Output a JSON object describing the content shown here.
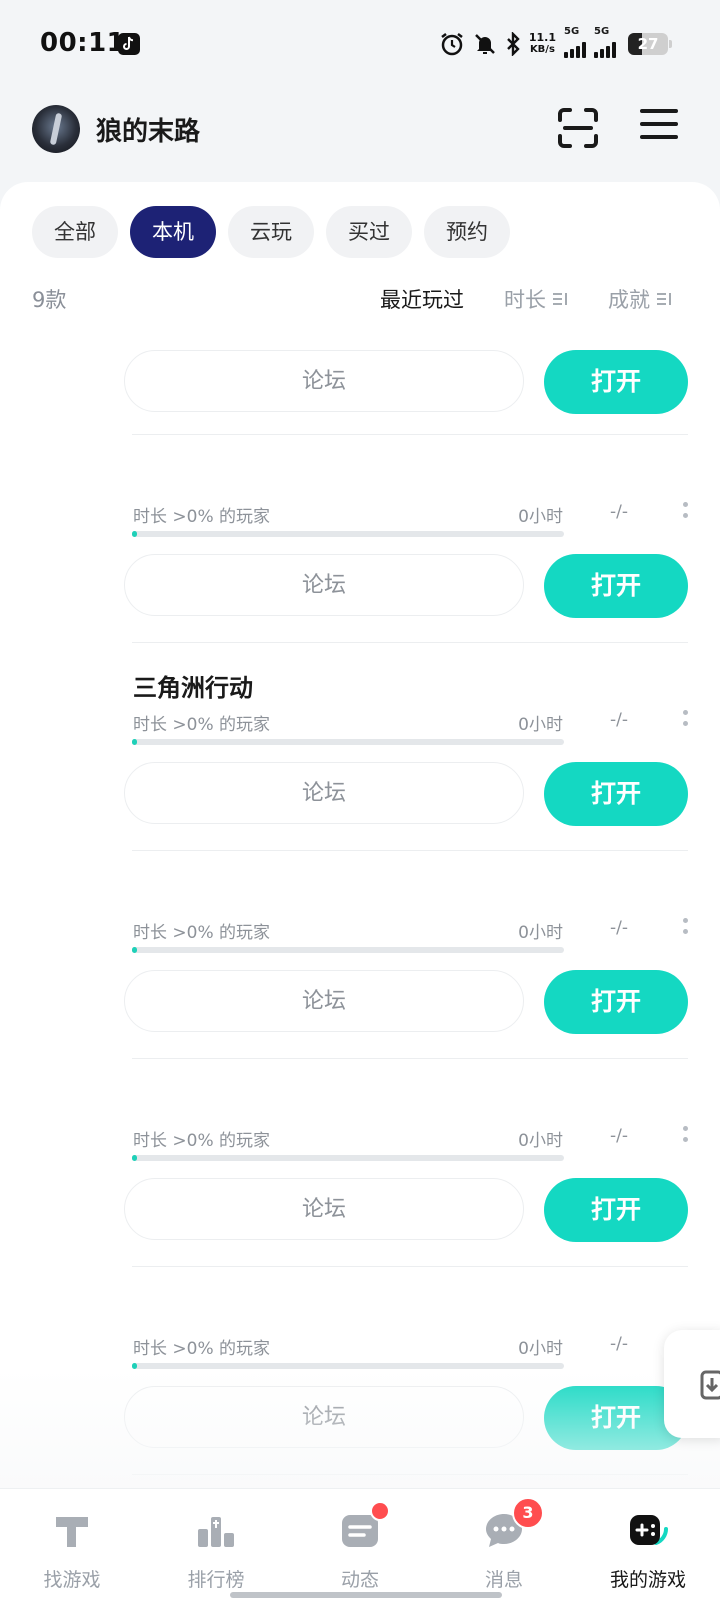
{
  "status_bar": {
    "time": "00:11",
    "net_speed_value": "11.1",
    "net_speed_unit": "KB/s",
    "sim1": "5G",
    "sim2": "5G",
    "battery": "27"
  },
  "header": {
    "username": "狼的末路"
  },
  "tabs": [
    {
      "label": "全部",
      "active": false
    },
    {
      "label": "本机",
      "active": true
    },
    {
      "label": "云玩",
      "active": false
    },
    {
      "label": "买过",
      "active": false
    },
    {
      "label": "预约",
      "active": false
    }
  ],
  "list_meta": {
    "count": "9款",
    "sort_recent": "最近玩过",
    "sort_duration": "时长",
    "sort_achievement": "成就"
  },
  "games": [
    {
      "title": "",
      "stat_label": "",
      "hours": "",
      "rank": "",
      "progress": 0.01,
      "forum_label": "论坛",
      "open_label": "打开",
      "show_stats": false
    },
    {
      "title": "",
      "stat_label": "时长 >0% 的玩家",
      "hours": "0小时",
      "rank": "-/-",
      "progress": 0.01,
      "forum_label": "论坛",
      "open_label": "打开",
      "show_stats": true
    },
    {
      "title": "三角洲行动",
      "stat_label": "时长 >0% 的玩家",
      "hours": "0小时",
      "rank": "-/-",
      "progress": 0.01,
      "forum_label": "论坛",
      "open_label": "打开",
      "show_stats": true
    },
    {
      "title": "",
      "stat_label": "时长 >0% 的玩家",
      "hours": "0小时",
      "rank": "-/-",
      "progress": 0.01,
      "forum_label": "论坛",
      "open_label": "打开",
      "show_stats": true
    },
    {
      "title": "",
      "stat_label": "时长 >0% 的玩家",
      "hours": "0小时",
      "rank": "-/-",
      "progress": 0.01,
      "forum_label": "论坛",
      "open_label": "打开",
      "show_stats": true
    },
    {
      "title": "",
      "stat_label": "时长 >0% 的玩家",
      "hours": "0小时",
      "rank": "-/-",
      "progress": 0.01,
      "forum_label": "论坛",
      "open_label": "打开",
      "show_stats": true
    }
  ],
  "bottom_nav": [
    {
      "label": "找游戏",
      "icon": "find-game-icon",
      "active": false
    },
    {
      "label": "排行榜",
      "icon": "ranking-icon",
      "active": false
    },
    {
      "label": "动态",
      "icon": "feed-icon",
      "active": false,
      "dot": true
    },
    {
      "label": "消息",
      "icon": "message-icon",
      "active": false,
      "badge": "3"
    },
    {
      "label": "我的游戏",
      "icon": "my-games-icon",
      "active": true
    }
  ],
  "colors": {
    "accent": "#14d8c2",
    "tab_active": "#1d2275",
    "badge": "#ff4d4f"
  }
}
